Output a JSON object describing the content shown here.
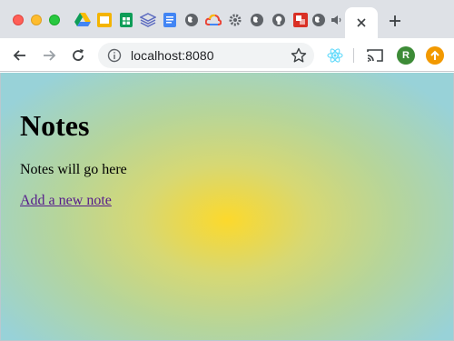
{
  "browser": {
    "address_bar": {
      "url": "localhost:8080"
    },
    "profile": {
      "initial": "R",
      "color": "#3d8b37"
    },
    "accent_colors": {
      "update": "#f29900",
      "react": "#61dafb"
    },
    "tabs": {
      "pinned_icons": [
        "google-drive-icon",
        "google-slides-icon",
        "google-sheets-icon",
        "layers-icon",
        "google-docs-icon",
        "globe-icon",
        "google-cloud-icon",
        "settings-gear-icon",
        "globe-icon",
        "github-icon",
        "red-square-icon",
        "globe-icon",
        "speaker-icon"
      ],
      "active_tab_icon": "close-icon"
    }
  },
  "page": {
    "heading": "Notes",
    "placeholder_text": "Notes will go here",
    "add_link_text": "Add a new note",
    "background_colors": [
      "#fcd92c",
      "#98d2d8"
    ]
  }
}
